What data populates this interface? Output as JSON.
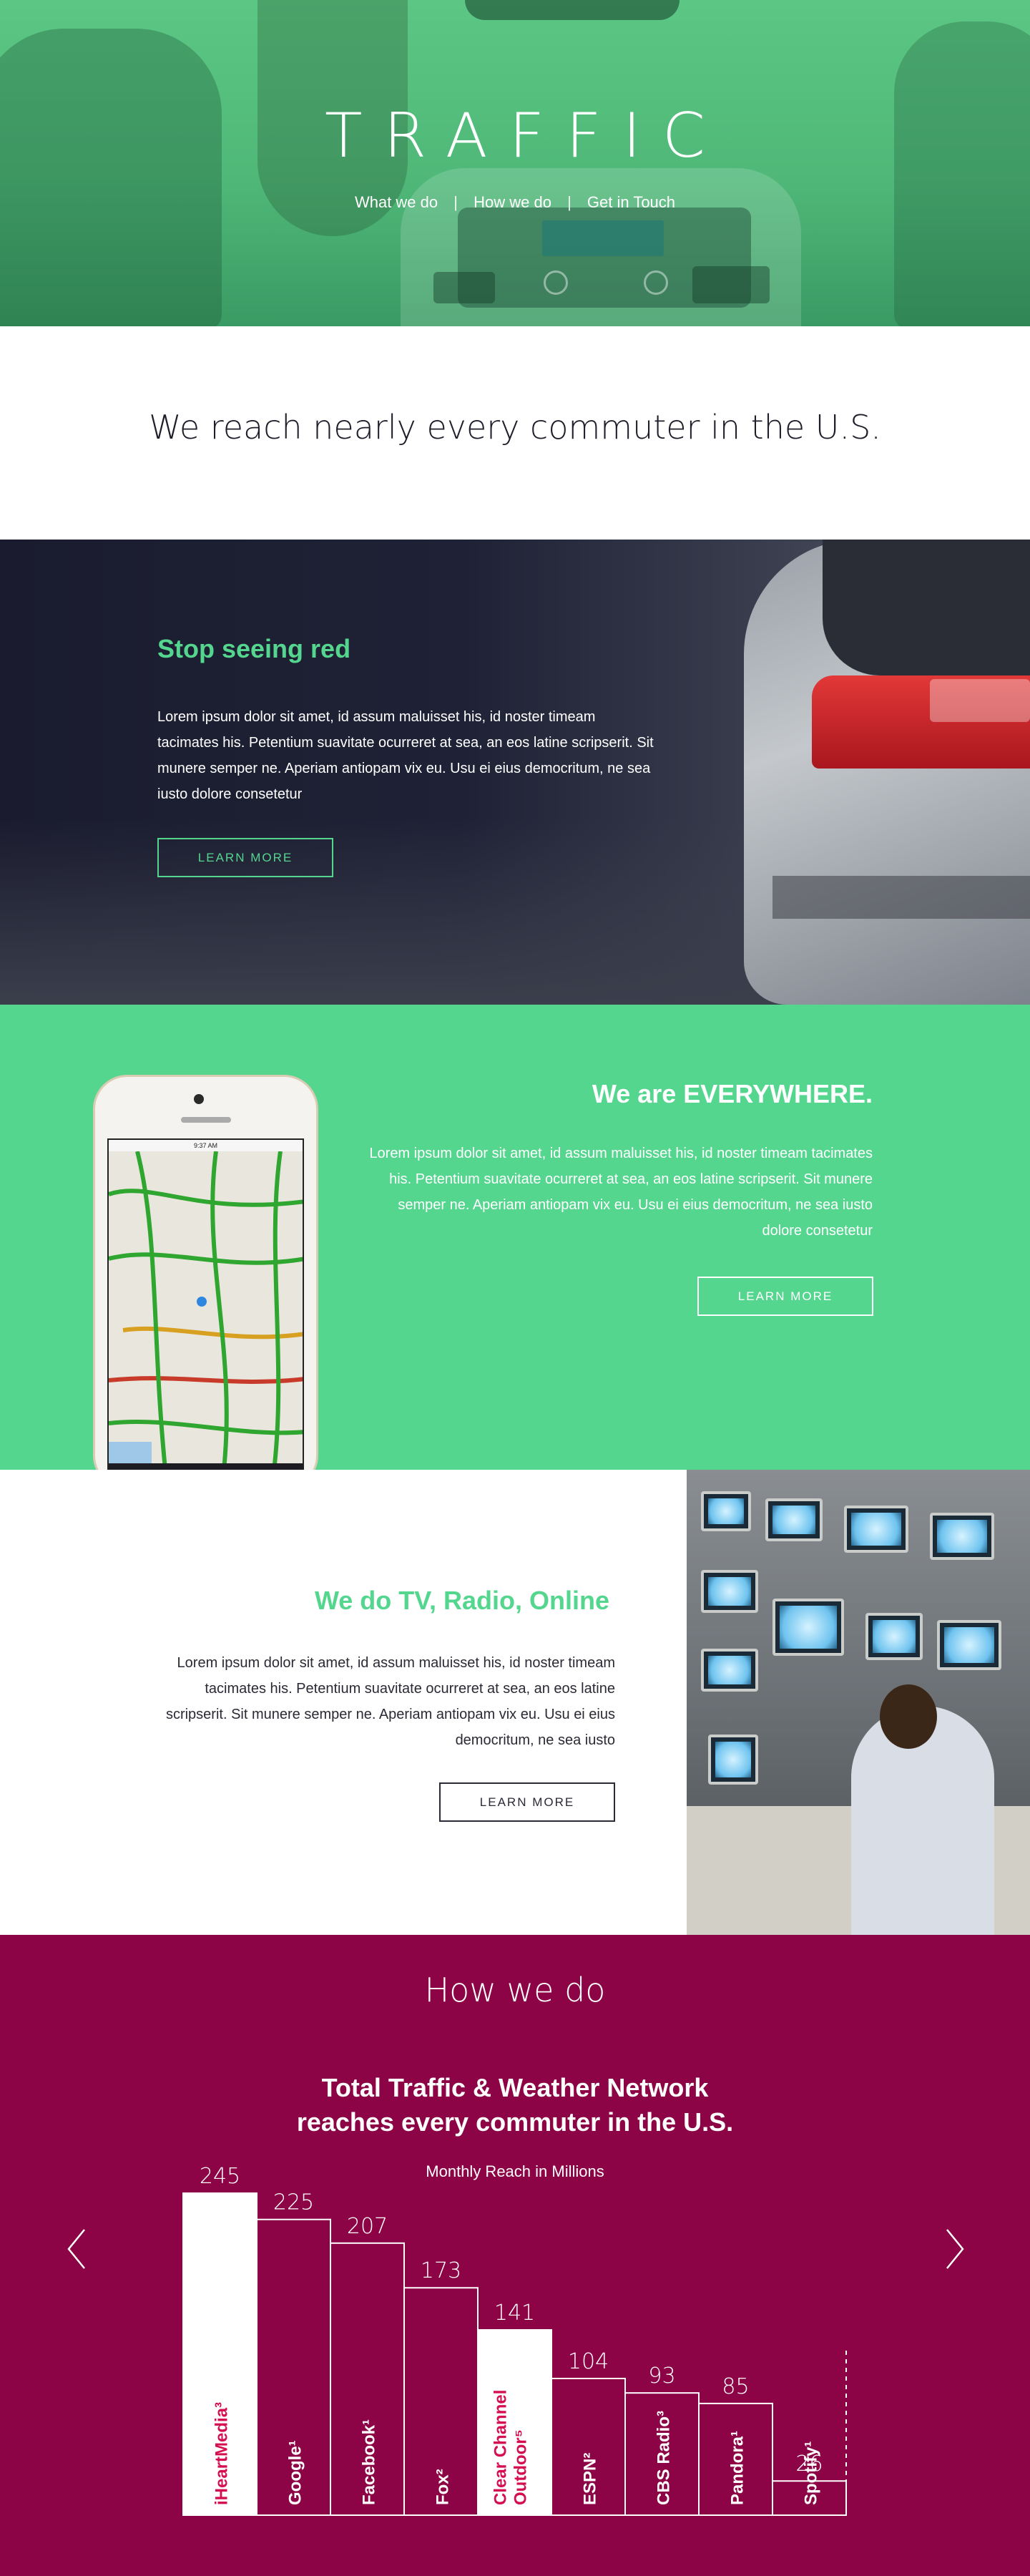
{
  "hero": {
    "title": "TRAFFIC",
    "nav": [
      "What we do",
      "How we do",
      "Get in Touch"
    ],
    "nav_separator": "|"
  },
  "intro": {
    "heading": "We reach nearly every commuter in the U.S."
  },
  "stop": {
    "heading": "Stop seeing red",
    "body": "Lorem ipsum dolor sit amet, id assum maluisset his, id noster timeam tacimates his. Petentium suavitate ocurreret at sea, an eos latine scripserit. Sit munere semper ne. Aperiam antiopam vix eu. Usu ei eius democritum, ne sea iusto dolore consetetur",
    "button": "LEARN MORE"
  },
  "everywhere": {
    "heading": "We are EVERYWHERE.",
    "body": "Lorem ipsum dolor sit amet, id assum maluisset his, id noster timeam tacimates his. Petentium suavitate ocurreret at sea, an eos latine scripserit. Sit munere semper ne. Aperiam antiopam vix eu. Usu ei eius democritum, ne sea iusto dolore consetetur",
    "button": "LEARN MORE",
    "phone_time": "9:37 AM"
  },
  "tv": {
    "heading": "We do TV, Radio, Online",
    "body": "Lorem ipsum dolor sit amet, id assum maluisset his, id noster timeam tacimates his. Petentium suavitate ocurreret at sea, an eos latine scripserit. Sit munere semper ne. Aperiam antiopam vix eu. Usu ei eius democritum, ne sea iusto",
    "button": "LEARN MORE"
  },
  "how": {
    "heading": "How we do",
    "chart_title_line1": "Total Traffic & Weather Network",
    "chart_title_line2": "reaches every commuter in the U.S.",
    "chart_subtitle": "Monthly Reach in Millions",
    "prev_icon": "chevron-left-icon",
    "next_icon": "chevron-right-icon"
  },
  "colors": {
    "green": "#55d68f",
    "magenta": "#8c0346",
    "highlight": "#d40e4f"
  },
  "chart_data": {
    "type": "bar",
    "title": "Total Traffic & Weather Network reaches every commuter in the U.S.",
    "subtitle": "Monthly Reach in Millions",
    "categories": [
      "iHeartMedia³",
      "Google¹",
      "Facebook¹",
      "Fox²",
      "Clear Channel Outdoor⁵",
      "ESPN²",
      "CBS Radio³",
      "Pandora¹",
      "Spotify¹"
    ],
    "values": [
      245,
      225,
      207,
      173,
      141,
      104,
      93,
      85,
      26
    ],
    "highlighted": [
      "iHeartMedia³",
      "Clear Channel Outdoor⁵"
    ],
    "ylim": [
      0,
      245
    ],
    "grid": false,
    "legend": "none"
  }
}
